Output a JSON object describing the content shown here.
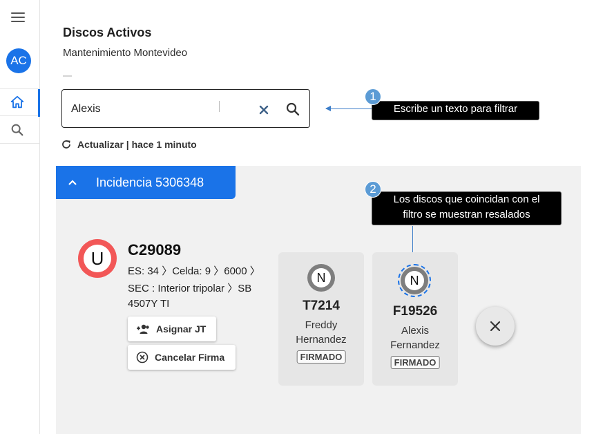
{
  "sidebar": {
    "avatar_initials": "AC",
    "items": [
      {
        "icon": "home-icon",
        "active": true
      },
      {
        "icon": "search-icon",
        "active": false
      }
    ]
  },
  "header": {
    "title": "Discos Activos",
    "subtitle": "Mantenimiento Montevideo"
  },
  "search": {
    "value": "Alexis",
    "placeholder": ""
  },
  "refresh": {
    "label": "Actualizar | hace 1 minuto"
  },
  "tooltips": [
    {
      "number": "1",
      "text": "Escribe un texto para filtrar"
    },
    {
      "number": "2",
      "text_line1": "Los discos que coincidan con el",
      "text_line2": "filtro se muestran resalados"
    }
  ],
  "incident": {
    "label": "Incidencia 5306348"
  },
  "disk": {
    "icon_letter": "U",
    "code": "C29089",
    "line1": "ES: 34 〉Celda: 9 〉6000 〉",
    "line2": "SEC : Interior tripolar 〉SB",
    "line3": "4507Y TI",
    "assign_label": "Asignar JT",
    "cancel_label": "Cancelar Firma"
  },
  "cards": [
    {
      "icon_letter": "N",
      "code": "T7214",
      "name_line1": "Freddy",
      "name_line2": "Hernandez",
      "badge": "FIRMADO",
      "highlighted": false
    },
    {
      "icon_letter": "N",
      "code": "F19526",
      "name_line1": "Alexis",
      "name_line2": "Fernandez",
      "badge": "FIRMADO",
      "highlighted": true
    }
  ],
  "colors": {
    "accent": "#1a73e8",
    "disk_icon": "#f25757",
    "tooltip_badge": "#5b9bd5"
  }
}
